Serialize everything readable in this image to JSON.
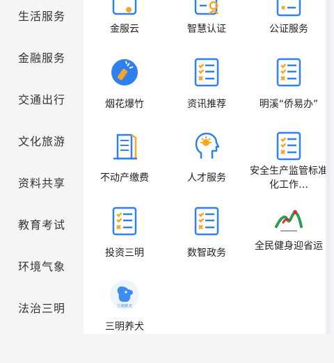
{
  "sidebar": {
    "items": [
      {
        "label": "生活服务"
      },
      {
        "label": "金融服务"
      },
      {
        "label": "交通出行"
      },
      {
        "label": "文化旅游"
      },
      {
        "label": "资料共享"
      },
      {
        "label": "教育考试"
      },
      {
        "label": "环境气象"
      },
      {
        "label": "法治三明"
      }
    ]
  },
  "grid": {
    "items": [
      {
        "label": "金服云",
        "icon": "card-icon"
      },
      {
        "label": "智慧认证",
        "icon": "id-verify-icon"
      },
      {
        "label": "公证服务",
        "icon": "checklist-icon"
      },
      {
        "label": "烟花爆竹",
        "icon": "firecracker-icon"
      },
      {
        "label": "资讯推荐",
        "icon": "checklist-icon"
      },
      {
        "label": "明溪“侨易办”",
        "icon": "checklist-icon"
      },
      {
        "label": "不动产缴费",
        "icon": "building-icon"
      },
      {
        "label": "人才服务",
        "icon": "talent-head-icon"
      },
      {
        "label": "安全生产监管标准化工作…",
        "icon": "checklist-icon"
      },
      {
        "label": "投资三明",
        "icon": "checklist-icon"
      },
      {
        "label": "数智政务",
        "icon": "checklist-icon"
      },
      {
        "label": "全民健身迎省运",
        "icon": "fitness-games-logo-icon"
      },
      {
        "label": "三明养犬",
        "icon": "dog-logo-icon",
        "logo_text": "三明养犬"
      }
    ]
  },
  "colors": {
    "accent": "#2f80ed",
    "check": "#f5a623",
    "sidebar_bg": "#f4f5f7",
    "panel_bg": "#ffffff"
  }
}
